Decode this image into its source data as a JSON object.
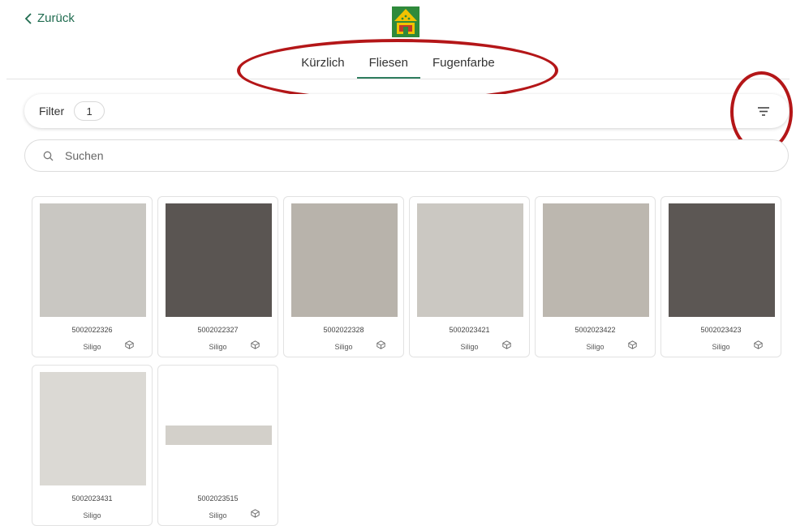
{
  "nav": {
    "back_label": "Zurück"
  },
  "tabs": [
    {
      "label": "Kürzlich",
      "active": false
    },
    {
      "label": "Fliesen",
      "active": true
    },
    {
      "label": "Fugenfarbe",
      "active": false
    }
  ],
  "filter": {
    "label": "Filter",
    "count": "1"
  },
  "search": {
    "placeholder": "Suchen"
  },
  "colors": {
    "accent": "#2e7d5e",
    "annotation": "#b41618",
    "logo_green": "#2f8a3b",
    "logo_yellow": "#f2c200"
  },
  "products": [
    {
      "code": "5002022326",
      "brand": "Siligo",
      "color": "#c9c7c2",
      "shape": "square",
      "icon": "tile-3d-icon"
    },
    {
      "code": "5002022327",
      "brand": "Siligo",
      "color": "#5a5552",
      "shape": "square",
      "icon": "tile-3d-icon"
    },
    {
      "code": "5002022328",
      "brand": "Siligo",
      "color": "#b8b3ab",
      "shape": "square",
      "icon": "tile-3d-icon"
    },
    {
      "code": "5002023421",
      "brand": "Siligo",
      "color": "#cbc8c2",
      "shape": "square",
      "icon": "tile-3d-icon"
    },
    {
      "code": "5002023422",
      "brand": "Siligo",
      "color": "#bcb7af",
      "shape": "square",
      "icon": "tile-3d-icon"
    },
    {
      "code": "5002023423",
      "brand": "Siligo",
      "color": "#5c5754",
      "shape": "square",
      "icon": "tile-3d-icon"
    },
    {
      "code": "5002023431",
      "brand": "Siligo",
      "color": "#dbd9d4",
      "shape": "square",
      "icon": ""
    },
    {
      "code": "5002023515",
      "brand": "Siligo",
      "color": "#d3d0ca",
      "shape": "strip",
      "icon": "tile-3d-icon"
    }
  ]
}
